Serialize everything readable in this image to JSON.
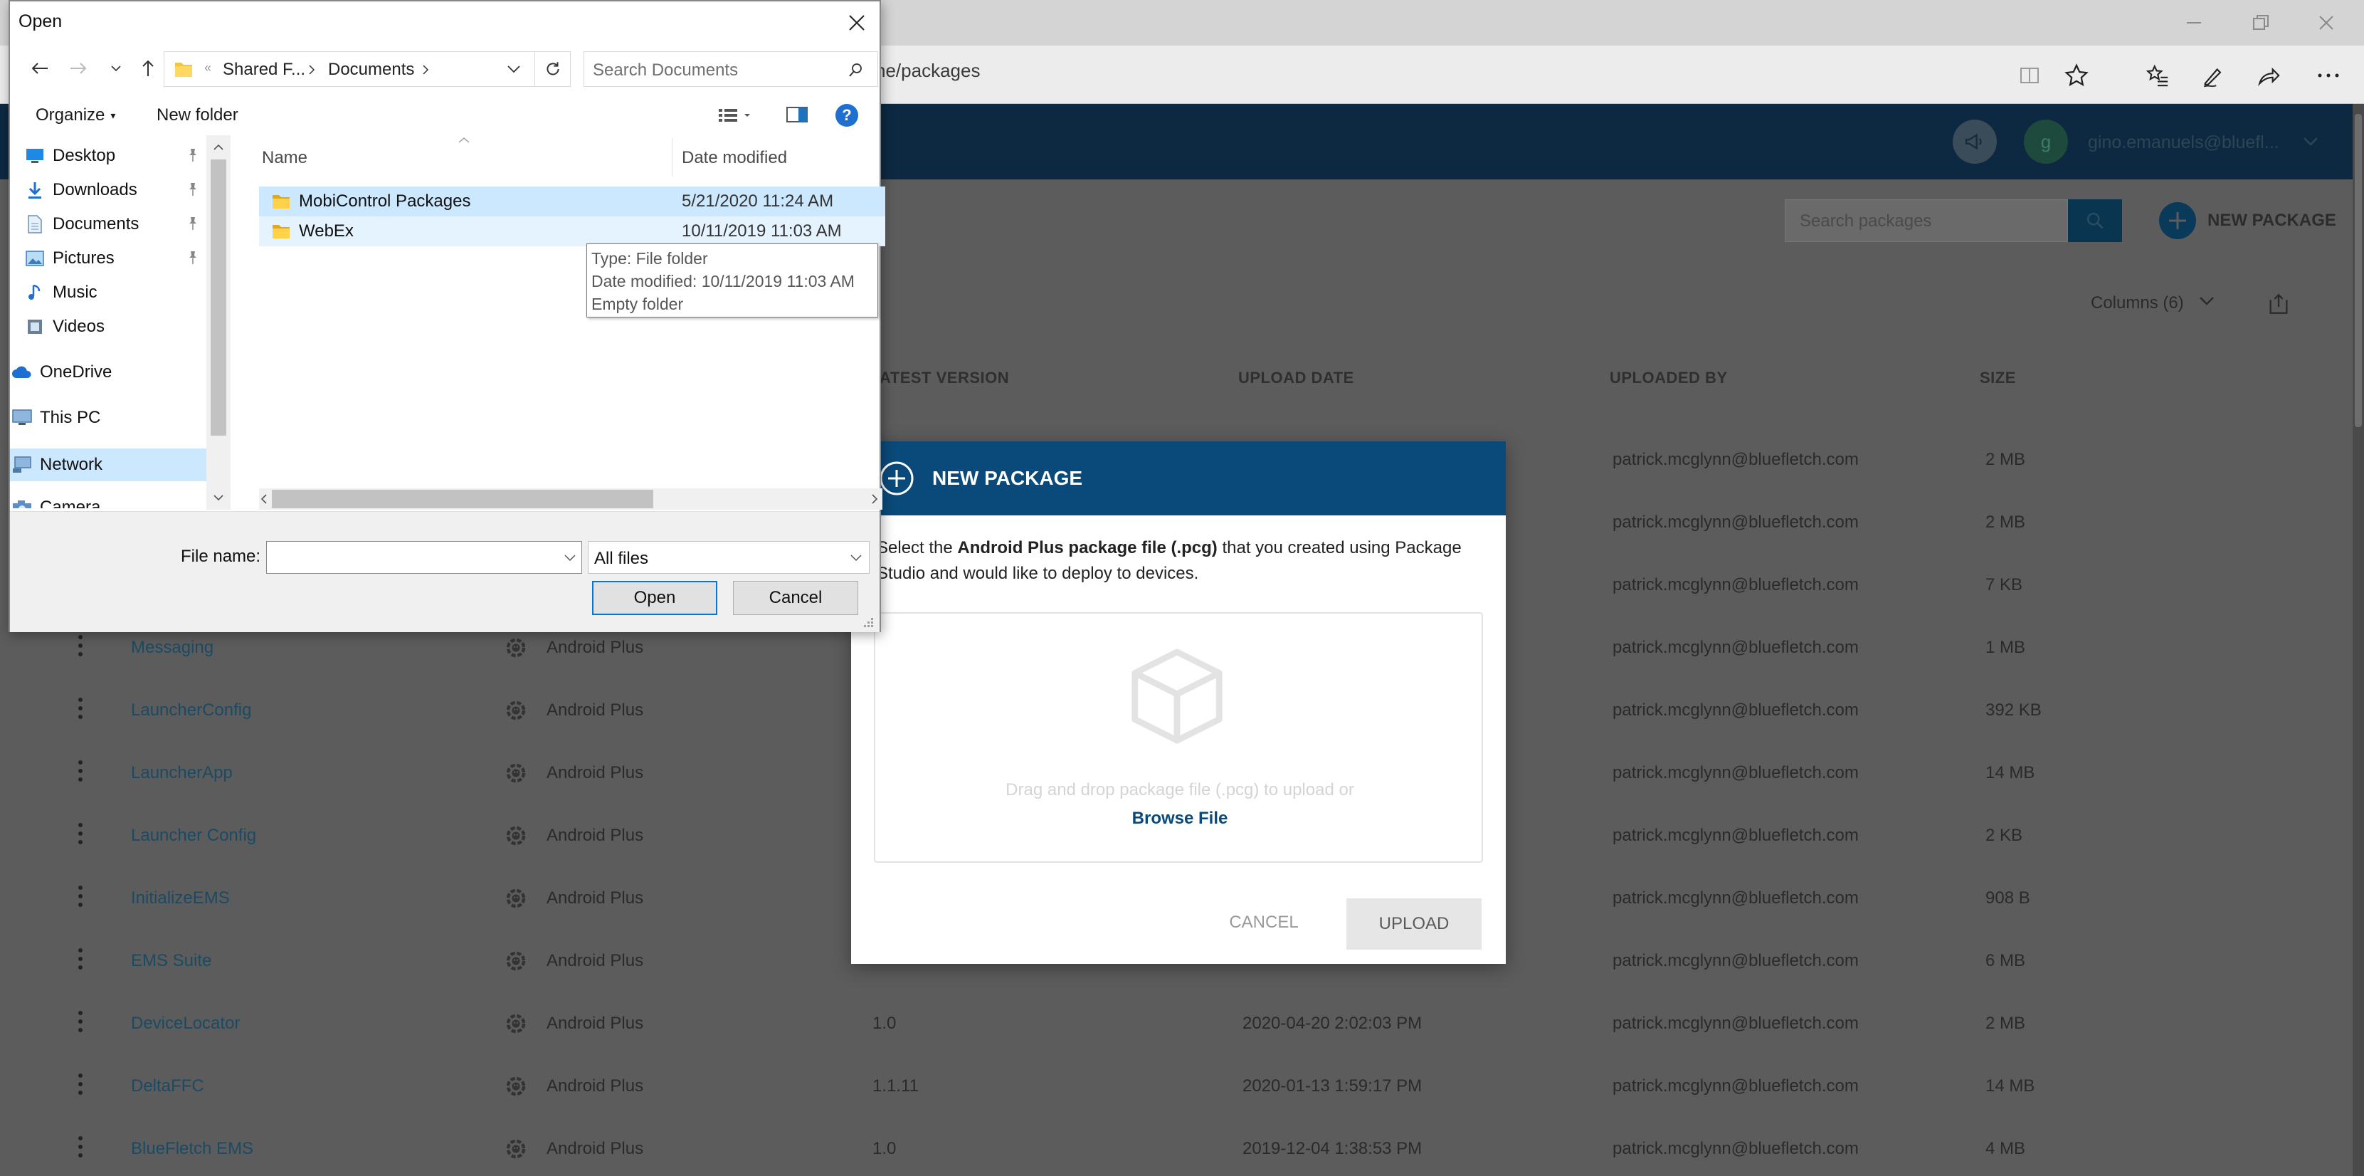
{
  "browser": {
    "url": "ne/packages"
  },
  "page": {
    "user_email": "gino.emanuels@bluefl...",
    "search_placeholder": "Search packages",
    "new_package_label": "NEW PACKAGE",
    "columns_label": "Columns (6)",
    "headers": {
      "latest_version": "ATEST VERSION",
      "upload_date": "UPLOAD DATE",
      "uploaded_by": "UPLOADED BY",
      "size": "SIZE"
    },
    "rows": [
      {
        "name": "",
        "platform": "",
        "version": "",
        "date": "",
        "by": "patrick.mcglynn@bluefletch.com",
        "size": "2 MB"
      },
      {
        "name": "",
        "platform": "",
        "version": "",
        "date": "",
        "by": "patrick.mcglynn@bluefletch.com",
        "size": "2 MB"
      },
      {
        "name": "",
        "platform": "",
        "version": "",
        "date": "",
        "by": "patrick.mcglynn@bluefletch.com",
        "size": "7 KB"
      },
      {
        "name": "Messaging",
        "platform": "Android Plus",
        "version": "",
        "date": "",
        "by": "patrick.mcglynn@bluefletch.com",
        "size": "1 MB"
      },
      {
        "name": "LauncherConfig",
        "platform": "Android Plus",
        "version": "",
        "date": "",
        "by": "patrick.mcglynn@bluefletch.com",
        "size": "392 KB"
      },
      {
        "name": "LauncherApp",
        "platform": "Android Plus",
        "version": "",
        "date": "",
        "by": "patrick.mcglynn@bluefletch.com",
        "size": "14 MB"
      },
      {
        "name": "Launcher Config",
        "platform": "Android Plus",
        "version": "",
        "date": "",
        "by": "patrick.mcglynn@bluefletch.com",
        "size": "2 KB"
      },
      {
        "name": "InitializeEMS",
        "platform": "Android Plus",
        "version": "",
        "date": "",
        "by": "patrick.mcglynn@bluefletch.com",
        "size": "908 B"
      },
      {
        "name": "EMS Suite",
        "platform": "Android Plus",
        "version": "",
        "date": "",
        "by": "patrick.mcglynn@bluefletch.com",
        "size": "6 MB"
      },
      {
        "name": "DeviceLocator",
        "platform": "Android Plus",
        "version": "1.0",
        "date": "2020-04-20 2:02:03 PM",
        "by": "patrick.mcglynn@bluefletch.com",
        "size": "2 MB"
      },
      {
        "name": "DeltaFFC",
        "platform": "Android Plus",
        "version": "1.1.11",
        "date": "2020-01-13 1:59:17 PM",
        "by": "patrick.mcglynn@bluefletch.com",
        "size": "14 MB"
      },
      {
        "name": "BlueFletch EMS",
        "platform": "Android Plus",
        "version": "1.0",
        "date": "2019-12-04 1:38:53 PM",
        "by": "patrick.mcglynn@bluefletch.com",
        "size": "4 MB"
      }
    ]
  },
  "modal": {
    "title": "NEW PACKAGE",
    "desc_pre": "Select the ",
    "desc_bold": "Android Plus package file (.pcg)",
    "desc_post": " that you created using Package Studio and would like to deploy to devices.",
    "drop_text": "Drag and drop package file (.pcg) to upload or",
    "browse_label": "Browse File",
    "cancel_label": "CANCEL",
    "upload_label": "UPLOAD"
  },
  "dialog": {
    "title": "Open",
    "breadcrumb": {
      "prefix": "«",
      "part1": "Shared F...",
      "part2": "Documents"
    },
    "search_placeholder": "Search Documents",
    "organize_label": "Organize",
    "new_folder_label": "New folder",
    "nav_items": [
      {
        "label": "Desktop",
        "icon": "desktop-icon",
        "pinned": true
      },
      {
        "label": "Downloads",
        "icon": "download-icon",
        "pinned": true
      },
      {
        "label": "Documents",
        "icon": "documents-icon",
        "pinned": true
      },
      {
        "label": "Pictures",
        "icon": "pictures-icon",
        "pinned": true
      },
      {
        "label": "Music",
        "icon": "music-icon",
        "pinned": false
      },
      {
        "label": "Videos",
        "icon": "videos-icon",
        "pinned": false
      },
      {
        "label": "OneDrive",
        "icon": "onedrive-icon",
        "pinned": false
      },
      {
        "label": "This PC",
        "icon": "pc-icon",
        "pinned": false
      },
      {
        "label": "Network",
        "icon": "network-icon",
        "pinned": false
      },
      {
        "label": "Camera",
        "icon": "camera-icon",
        "pinned": false
      }
    ],
    "col_name": "Name",
    "col_date": "Date modified",
    "files": [
      {
        "name": "MobiControl Packages",
        "date": "5/21/2020 11:24 AM"
      },
      {
        "name": "WebEx",
        "date": "10/11/2019 11:03 AM"
      }
    ],
    "tooltip": {
      "line1": "Type: File folder",
      "line2": "Date modified: 10/11/2019 11:03 AM",
      "line3": "Empty folder"
    },
    "file_name_label": "File name:",
    "file_name_value": "",
    "filter_value": "All files",
    "open_label": "Open",
    "cancel_label": "Cancel"
  },
  "colors": {
    "header_navy": "#0d2942",
    "modal_blue": "#0a4a7a",
    "selection": "#cce8ff",
    "win_accent": "#0078d7"
  }
}
